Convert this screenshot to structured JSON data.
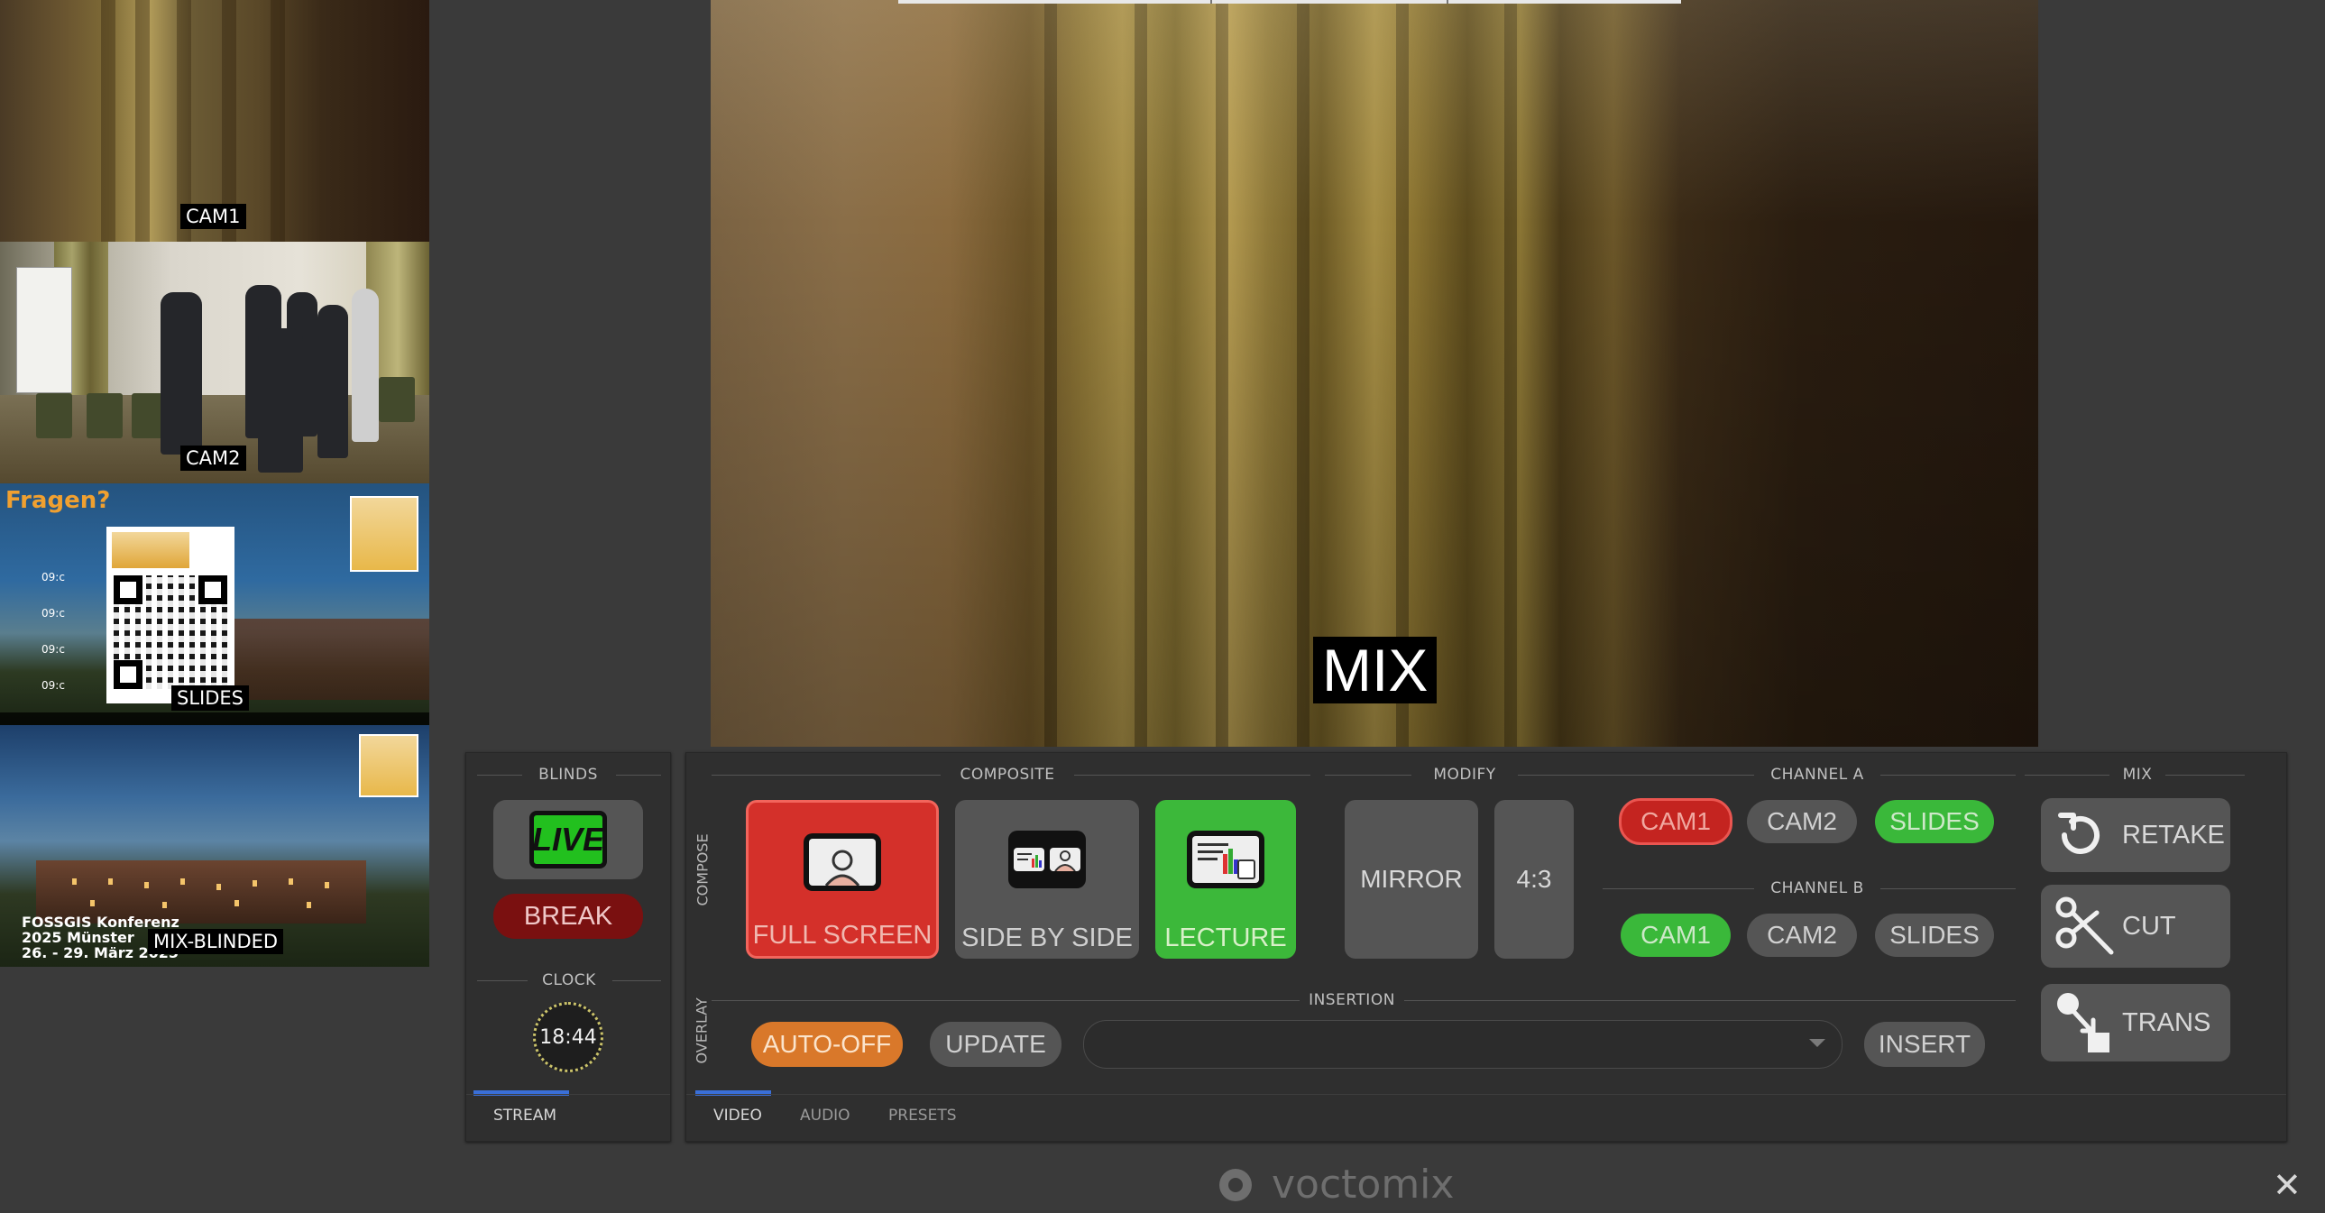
{
  "window": {
    "app_name": "voctomix",
    "close_glyph": "✕"
  },
  "previews": [
    {
      "label": "CAM1"
    },
    {
      "label": "CAM2"
    },
    {
      "label": "SLIDES",
      "slide_heading": "Fragen?",
      "times": [
        "09:c",
        "09:c",
        "09:c",
        "09:c"
      ]
    },
    {
      "label": "MIX-BLINDED",
      "conference_line1": "FOSSGIS Konferenz",
      "conference_line2": "2025 Münster",
      "conference_line3": "26. - 29. März 2025"
    }
  ],
  "program": {
    "label": "MIX"
  },
  "blinds": {
    "title": "BLINDS",
    "live_label": "LIVE",
    "break_label": "BREAK",
    "clock_title": "CLOCK",
    "clock_time": "18:44",
    "tab": "STREAM"
  },
  "compose": {
    "side_label": "COMPOSE",
    "composite_title": "COMPOSITE",
    "buttons": [
      {
        "label": "FULL SCREEN",
        "state": "active-red"
      },
      {
        "label": "SIDE BY SIDE",
        "state": "inactive"
      },
      {
        "label": "LECTURE",
        "state": "active-green"
      }
    ],
    "modify_title": "MODIFY",
    "mirror_label": "MIRROR",
    "aspect_label": "4:3",
    "channel_a_title": "CHANNEL A",
    "channel_a": [
      {
        "label": "CAM1",
        "state": "red"
      },
      {
        "label": "CAM2",
        "state": "grey"
      },
      {
        "label": "SLIDES",
        "state": "green"
      }
    ],
    "channel_b_title": "CHANNEL B",
    "channel_b": [
      {
        "label": "CAM1",
        "state": "green"
      },
      {
        "label": "CAM2",
        "state": "grey"
      },
      {
        "label": "SLIDES",
        "state": "grey"
      }
    ]
  },
  "mix": {
    "title": "MIX",
    "retake_label": "RETAKE",
    "cut_label": "CUT",
    "trans_label": "TRANS"
  },
  "overlay": {
    "side_label": "OVERLAY",
    "insertion_title": "INSERTION",
    "auto_off_label": "AUTO-OFF",
    "update_label": "UPDATE",
    "insertion_value": "",
    "insert_label": "INSERT"
  },
  "tabs": [
    {
      "label": "VIDEO",
      "active": true
    },
    {
      "label": "AUDIO",
      "active": false
    },
    {
      "label": "PRESETS",
      "active": false
    }
  ],
  "colors": {
    "background": "#3a3a3a",
    "panel": "#2f2f2f",
    "red_active": "#d4302a",
    "green_active": "#3cb83a",
    "orange": "#d9782a",
    "tab_underline": "#3a6fd8"
  }
}
